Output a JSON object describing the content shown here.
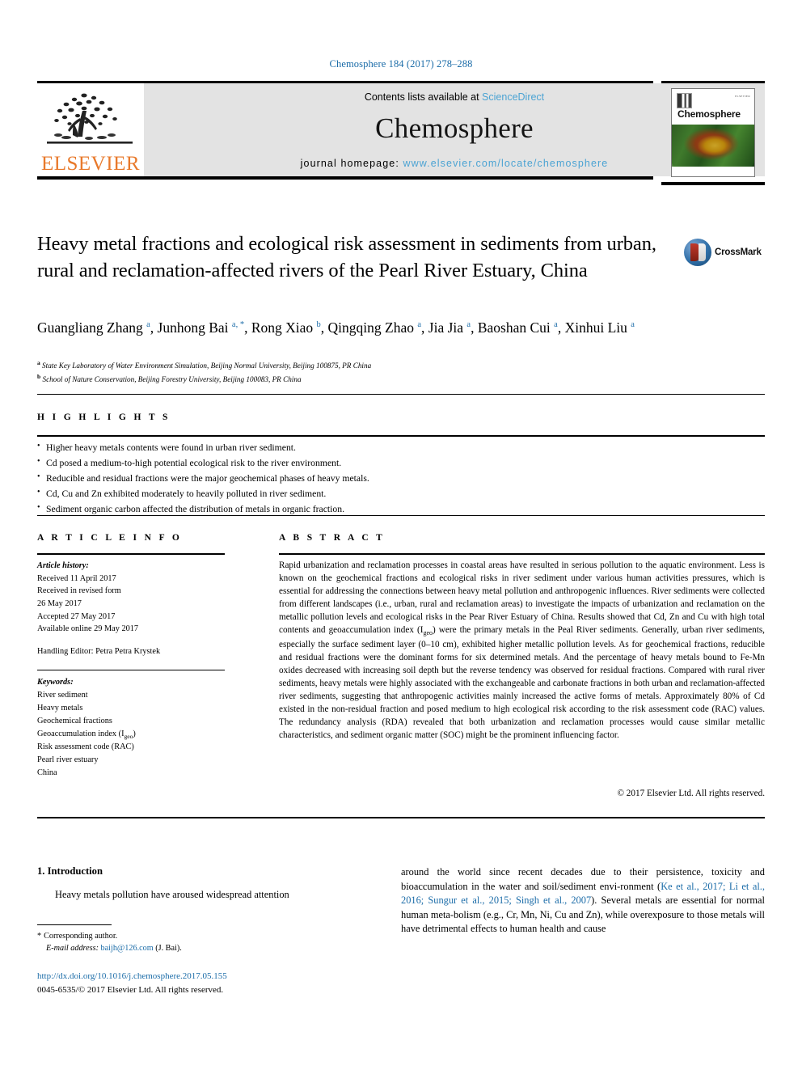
{
  "running_head": "Chemosphere 184 (2017) 278–288",
  "masthead": {
    "contents_prefix": "Contents lists available at ",
    "sciencedirect": "ScienceDirect",
    "journal_name": "Chemosphere",
    "homepage_prefix": "journal homepage: ",
    "homepage_url": "www.elsevier.com/locate/chemosphere",
    "publisher_wordmark": "ELSEVIER",
    "cover_title": "Chemosphere",
    "cover_tiny_label": "ELSEVIER"
  },
  "article": {
    "title": "Heavy metal fractions and ecological risk assessment in sediments from urban, rural and reclamation-affected rivers of the Pearl River Estuary, China",
    "crossmark_label": "CrossMark",
    "authors_html": "Guangliang Zhang <sup>a</sup>, Junhong Bai <sup>a, *</sup>, Rong Xiao <sup>b</sup>, Qingqing Zhao <sup>a</sup>, Jia Jia <sup>a</sup>, Baoshan Cui <sup>a</sup>, Xinhui Liu <sup>a</sup>",
    "affiliations": [
      {
        "marker": "a",
        "text": "State Key Laboratory of Water Environment Simulation, Beijing Normal University, Beijing 100875, PR China"
      },
      {
        "marker": "b",
        "text": "School of Nature Conservation, Beijing Forestry University, Beijing 100083, PR China"
      }
    ]
  },
  "highlights": {
    "heading": "H I G H L I G H T S",
    "items": [
      "Higher heavy metals contents were found in urban river sediment.",
      "Cd posed a medium-to-high potential ecological risk to the river environment.",
      "Reducible and residual fractions were the major geochemical phases of heavy metals.",
      "Cd, Cu and Zn exhibited moderately to heavily polluted in river sediment.",
      "Sediment organic carbon affected the distribution of metals in organic fraction."
    ]
  },
  "article_info": {
    "heading": "A R T I C L E  I N F O",
    "history_label": "Article history:",
    "history_lines": [
      "Received 11 April 2017",
      "Received in revised form",
      "26 May 2017",
      "Accepted 27 May 2017",
      "Available online 29 May 2017"
    ],
    "handling_editor": "Handling Editor: Petra Petra Krystek",
    "keywords_label": "Keywords:",
    "keywords": [
      "River sediment",
      "Heavy metals",
      "Geochemical fractions",
      "Geoaccumulation index (Igeo)",
      "Risk assessment code (RAC)",
      "Pearl river estuary",
      "China"
    ]
  },
  "abstract": {
    "heading": "A B S T R A C T",
    "text": "Rapid urbanization and reclamation processes in coastal areas have resulted in serious pollution to the aquatic environment. Less is known on the geochemical fractions and ecological risks in river sediment under various human activities pressures, which is essential for addressing the connections between heavy metal pollution and anthropogenic influences. River sediments were collected from different landscapes (i.e., urban, rural and reclamation areas) to investigate the impacts of urbanization and reclamation on the metallic pollution levels and ecological risks in the Pear River Estuary of China. Results showed that Cd, Zn and Cu with high total contents and geoaccumulation index (Igeo) were the primary metals in the Peal River sediments. Generally, urban river sediments, especially the surface sediment layer (0–10 cm), exhibited higher metallic pollution levels. As for geochemical fractions, reducible and residual fractions were the dominant forms for six determined metals. And the percentage of heavy metals bound to Fe-Mn oxides decreased with increasing soil depth but the reverse tendency was observed for residual fractions. Compared with rural river sediments, heavy metals were highly associated with the exchangeable and carbonate fractions in both urban and reclamation-affected river sediments, suggesting that anthropogenic activities mainly increased the active forms of metals. Approximately 80% of Cd existed in the non-residual fraction and posed medium to high ecological risk according to the risk assessment code (RAC) values. The redundancy analysis (RDA) revealed that both urbanization and reclamation processes would cause similar metallic characteristics, and sediment organic matter (SOC) might be the prominent influencing factor.",
    "copyright": "© 2017 Elsevier Ltd. All rights reserved."
  },
  "body": {
    "section_number_title": "1. Introduction",
    "left_paragraph": "Heavy metals pollution have aroused widespread attention",
    "right_paragraph_part1": "around the world since recent decades due to their persistence, toxicity and bioaccumulation in the water and soil/sediment envi-ronment (",
    "right_citation": "Ke et al., 2017; Li et al., 2016; Sungur et al., 2015; Singh et al., 2007",
    "right_paragraph_part2": "). Several metals are essential for normal human meta-bolism (e.g., Cr, Mn, Ni, Cu and Zn), while overexposure to those metals will have detrimental effects to human health and cause"
  },
  "footnote": {
    "corresponding": "Corresponding author.",
    "email_label": "E-mail address:",
    "email": "baijh@126.com",
    "email_suffix": "(J. Bai)."
  },
  "footer": {
    "doi": "http://dx.doi.org/10.1016/j.chemosphere.2017.05.155",
    "issn_line": "0045-6535/© 2017 Elsevier Ltd. All rights reserved."
  },
  "colors": {
    "link_blue": "#1b6ca8",
    "sciencedirect_blue": "#4ba3d3",
    "elsevier_orange": "#e8792b"
  }
}
